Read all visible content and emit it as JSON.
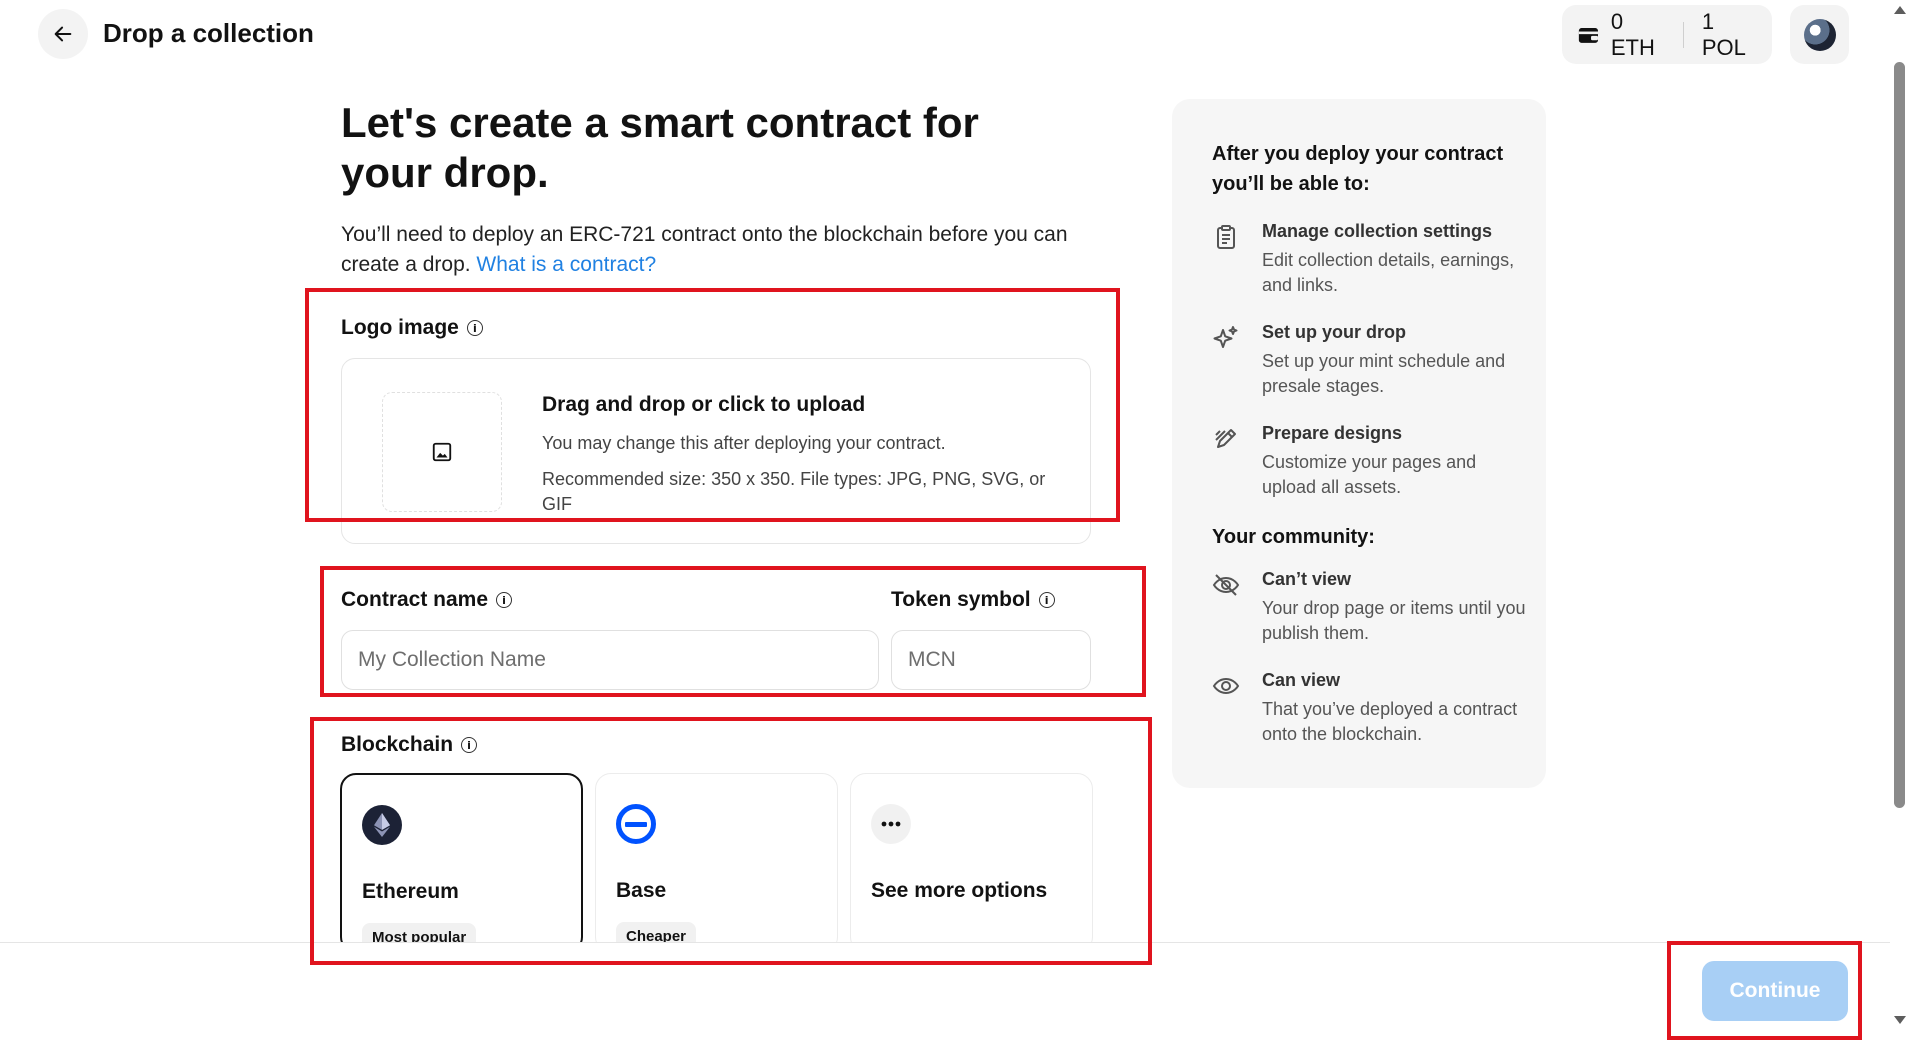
{
  "header": {
    "title": "Drop a collection",
    "wallet": {
      "eth": "0 ETH",
      "pol": "1 POL"
    }
  },
  "main": {
    "headline": "Let's create a smart contract for your drop.",
    "intro": "You’ll need to deploy an ERC-721 contract onto the blockchain before you can create a drop. ",
    "intro_link": "What is a contract?",
    "logo": {
      "label": "Logo image",
      "upload_title": "Drag and drop or click to upload",
      "upload_note": "You may change this after deploying your contract.",
      "upload_rec": "Recommended size: 350 x 350. File types: JPG, PNG, SVG, or GIF"
    },
    "contract_name": {
      "label": "Contract name",
      "placeholder": "My Collection Name"
    },
    "token_symbol": {
      "label": "Token symbol",
      "placeholder": "MCN"
    },
    "blockchain": {
      "label": "Blockchain",
      "options": [
        {
          "name": "Ethereum",
          "badge": "Most popular",
          "icon": "ethereum-icon",
          "selected": true
        },
        {
          "name": "Base",
          "badge": "Cheaper",
          "icon": "base-icon",
          "selected": false
        },
        {
          "name": "See more options",
          "icon": "more-icon",
          "selected": false
        }
      ]
    }
  },
  "side": {
    "title": "After you deploy your contract you’ll be able to:",
    "features": [
      {
        "icon": "clipboard-icon",
        "title": "Manage collection settings",
        "desc": "Edit collection details, earnings, and links."
      },
      {
        "icon": "sparkle-icon",
        "title": "Set up your drop",
        "desc": "Set up your mint schedule and presale stages."
      },
      {
        "icon": "pen-icon",
        "title": "Prepare designs",
        "desc": "Customize your pages and upload all assets."
      }
    ],
    "community_title": "Your community:",
    "community": [
      {
        "icon": "eye-off-icon",
        "title": "Can’t view",
        "desc": "Your drop page or items until you publish them."
      },
      {
        "icon": "eye-icon",
        "title": "Can view",
        "desc": "That you’ve deployed a contract onto the blockchain."
      }
    ]
  },
  "footer": {
    "continue_label": "Continue"
  },
  "colors": {
    "link": "#2081e2",
    "annotation": "#e0141e",
    "continue_disabled": "#a8cff5",
    "base_blue": "#0052ff"
  }
}
